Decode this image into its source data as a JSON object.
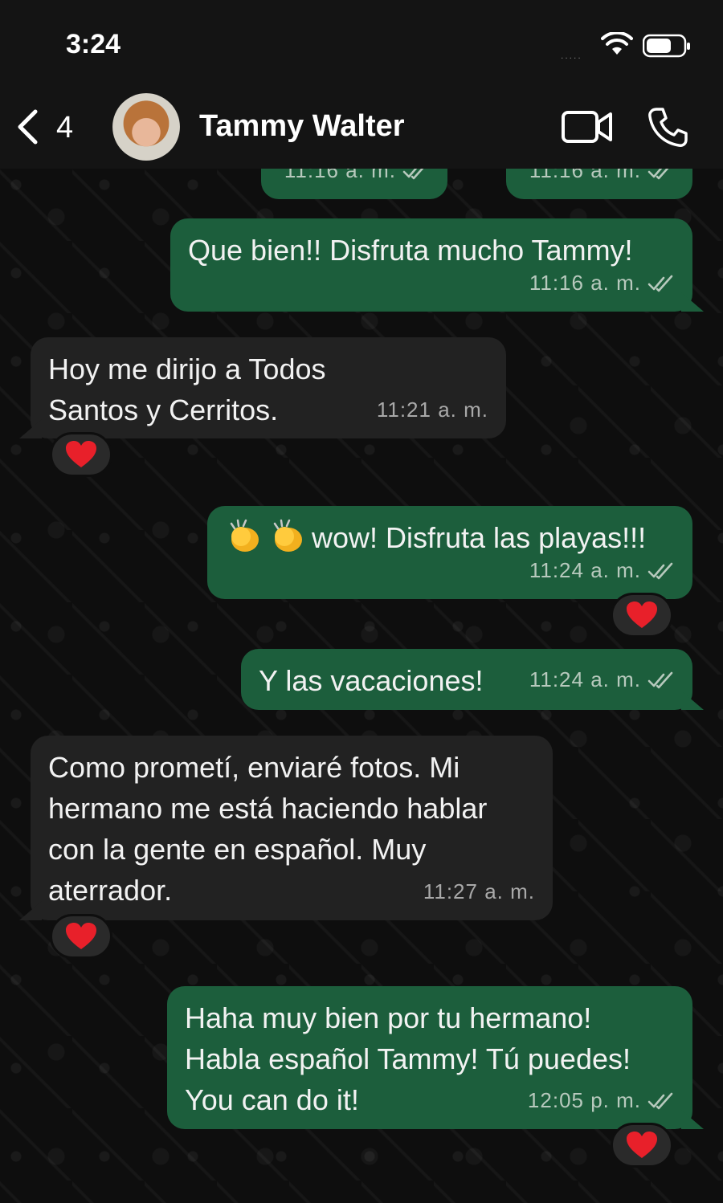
{
  "status_bar": {
    "time": "3:24",
    "signal": "....."
  },
  "header": {
    "back_count": "4",
    "contact_name": "Tammy Walter"
  },
  "messages": [
    {
      "direction": "out",
      "text": "",
      "time": "11:16 a. m.",
      "partial": true
    },
    {
      "direction": "out",
      "text": "",
      "time": "11:16 a. m.",
      "partial": true
    },
    {
      "direction": "out",
      "text": "Que bien!! Disfruta mucho Tammy!",
      "time": "11:16 a. m."
    },
    {
      "direction": "in",
      "text": "Hoy me dirijo a Todos Santos y Cerritos.",
      "time": "11:21 a. m.",
      "reaction": "heart"
    },
    {
      "direction": "out",
      "emoji": "clapping-hands x2",
      "text": "wow! Disfruta las playas!!!",
      "time": "11:24 a. m.",
      "reaction": "heart"
    },
    {
      "direction": "out",
      "text": "Y las vacaciones!",
      "time": "11:24 a. m."
    },
    {
      "direction": "in",
      "text": "Como prometí, enviaré fotos. Mi hermano me está haciendo hablar con la gente en español. Muy aterrador.",
      "time": "11:27 a. m.",
      "reaction": "heart"
    },
    {
      "direction": "out",
      "text": "Haha muy bien por tu hermano! Habla español Tammy! Tú puedes! You can do it!",
      "time": "12:05 p. m.",
      "reaction": "heart"
    }
  ],
  "colors": {
    "outgoing_bubble": "#1c5e3c",
    "incoming_bubble": "#222222",
    "heart": "#e8202a"
  }
}
